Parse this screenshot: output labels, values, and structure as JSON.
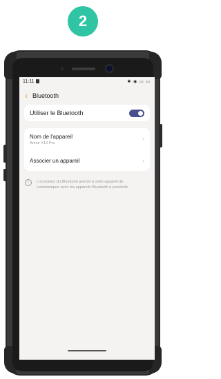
{
  "step": {
    "number": "2",
    "color": "#2ec4a4"
  },
  "status_bar": {
    "time": "11:11",
    "icons": "✱ ◉ ▭ ▭"
  },
  "header": {
    "back_icon": "chevron-left-icon",
    "title": "Bluetooth"
  },
  "bluetooth_toggle": {
    "label": "Utiliser le Bluetooth",
    "enabled": true
  },
  "settings_list": [
    {
      "title": "Nom de l'appareil",
      "subtitle": "Armor X12 Pro"
    },
    {
      "title": "Associer un appareil",
      "subtitle": ""
    }
  ],
  "info": {
    "icon": "info-icon",
    "text": "L'activation du Bluetooth permet à votre appareil de communiquer avec les appareils Bluetooth à proximité."
  }
}
